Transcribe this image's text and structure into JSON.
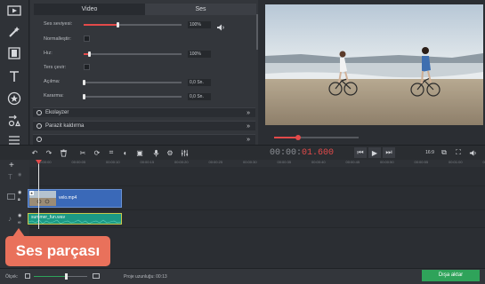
{
  "properties": {
    "tabs": [
      {
        "label": "Video",
        "active": true
      },
      {
        "label": "Ses",
        "active": false
      }
    ],
    "rows": [
      {
        "label": "Ses seviyesi:",
        "value": "100%",
        "type": "slider",
        "level": 0.35
      },
      {
        "label": "Normalleştir:",
        "type": "checkbox"
      },
      {
        "label": "Hız:",
        "value": "100%",
        "type": "slider",
        "level": 0.06
      },
      {
        "label": "Ters çevir:",
        "type": "checkbox"
      },
      {
        "label": "Açılma:",
        "value": "0,0 Sn.",
        "type": "slider",
        "level": 0.0
      },
      {
        "label": "Kararma:",
        "value": "0,0 Sn.",
        "type": "slider",
        "level": 0.0
      }
    ],
    "sections": [
      {
        "label": "Ekolayzer"
      },
      {
        "label": "Parazit kaldırma"
      }
    ]
  },
  "player": {
    "timecode_prefix": "00:00:",
    "timecode_highlight": "01.600",
    "aspect_label": "16:9",
    "progress": 0.14
  },
  "timeline": {
    "ticks": [
      "00:00:00",
      "00:00:05",
      "00:00:10",
      "00:00:15",
      "00:00:20",
      "00:00:25",
      "00:00:30",
      "00:00:35",
      "00:00:40",
      "00:00:45",
      "00:00:50",
      "00:00:55",
      "00:01:00",
      "00:01:05"
    ],
    "video_clip_name": "velo.mp4",
    "audio_clip_name": "summer_fun.wav"
  },
  "status": {
    "scale_label": "Ölçek:",
    "duration_label": "Proje uzunluğu:",
    "duration_value": "00:13",
    "export_label": "Dışa aktar"
  },
  "callout": {
    "text": "Ses parçası"
  },
  "colors": {
    "accent": "#e34a4a",
    "export": "#2fa35a",
    "callout": "#e9715b",
    "video_clip": "#3a69b8",
    "audio_clip": "#1c9a85"
  }
}
